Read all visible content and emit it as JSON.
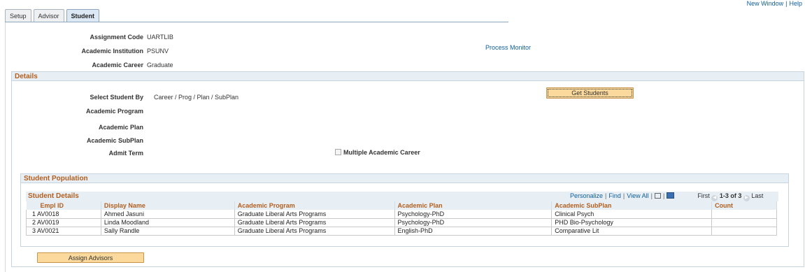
{
  "tabs": [
    {
      "label": "Setup",
      "active": false
    },
    {
      "label": "Advisor",
      "active": false
    },
    {
      "label": "Student",
      "active": true
    }
  ],
  "top_links": {
    "new_window": "New Window",
    "separator": "|",
    "help": "Help"
  },
  "header": {
    "assignment_code": {
      "label": "Assignment Code",
      "value": "UARTLIB"
    },
    "academic_institution": {
      "label": "Academic Institution",
      "value": "PSUNV"
    },
    "academic_career": {
      "label": "Academic Career",
      "value": "Graduate"
    },
    "process_monitor": "Process Monitor"
  },
  "details": {
    "title": "Details",
    "select_student_by": {
      "label": "Select Student By",
      "value": "Career / Prog / Plan / SubPlan"
    },
    "get_students_button": "Get Students",
    "academic_program_label": "Academic Program",
    "academic_plan_label": "Academic Plan",
    "academic_subplan_label": "Academic SubPlan",
    "admit_term_label": "Admit Term",
    "multiple_academic_career": {
      "label": "Multiple Academic Career",
      "checked": false
    }
  },
  "population": {
    "title": "Student Population",
    "grid": {
      "title": "Student Details",
      "personalize": "Personalize",
      "find": "Find",
      "view_all": "View All",
      "first": "First",
      "range": "1-3 of 3",
      "last": "Last",
      "columns": [
        "Empl ID",
        "Display Name",
        "Academic Program",
        "Academic Plan",
        "Academic SubPlan",
        "Count"
      ],
      "rows": [
        {
          "num": "1",
          "empl_id": "AV0018",
          "name": "Ahmed Jasuni",
          "program": "Graduate Liberal Arts Programs",
          "plan": "Psychology-PhD",
          "subplan": "Clinical Psych",
          "count": ""
        },
        {
          "num": "2",
          "empl_id": "AV0019",
          "name": "Linda Moodland",
          "program": "Graduate Liberal Arts Programs",
          "plan": "Psychology-PhD",
          "subplan": "PHD Bio-Psychology",
          "count": ""
        },
        {
          "num": "3",
          "empl_id": "AV0021",
          "name": "Sally Randle",
          "program": "Graduate Liberal Arts Programs",
          "plan": "English-PhD",
          "subplan": "Comparative Lit",
          "count": ""
        }
      ]
    }
  },
  "assign_advisors_button": "Assign Advisors",
  "colors": {
    "section_title": "#b35f1f",
    "link": "#0e5d9a",
    "button_bg": "#fbd89b",
    "header_bg": "#e7eef4"
  }
}
